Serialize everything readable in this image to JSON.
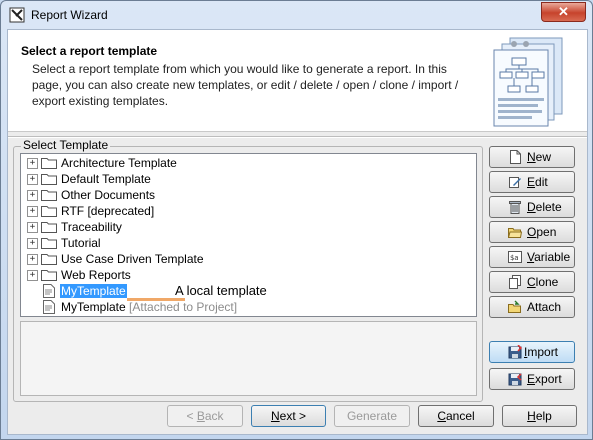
{
  "window": {
    "title": "Report Wizard",
    "close_symbol": "✕"
  },
  "header": {
    "title": "Select a report template",
    "description": "Select a report template from which you would like to generate a report. In this page, you can also create new templates, or edit / delete / open / clone / import / export existing templates."
  },
  "group": {
    "label": "Select Template"
  },
  "tree": {
    "folders": [
      {
        "label": "Architecture Template"
      },
      {
        "label": "Default Template"
      },
      {
        "label": "Other Documents"
      },
      {
        "label": "RTF [deprecated]"
      },
      {
        "label": "Traceability"
      },
      {
        "label": "Tutorial"
      },
      {
        "label": "Use Case Driven Template"
      },
      {
        "label": "Web Reports"
      }
    ],
    "templates": [
      {
        "label": "MyTemplate",
        "selected": true
      },
      {
        "label": "MyTemplate",
        "suffix": "[Attached to Project]"
      }
    ],
    "expander_symbol": "+",
    "annotation": "A local template"
  },
  "side_buttons": [
    {
      "key": "N",
      "rest": "ew",
      "icon": "new-document-icon"
    },
    {
      "key": "E",
      "rest": "dit",
      "icon": "edit-pencil-icon"
    },
    {
      "key": "D",
      "rest": "elete",
      "icon": "trash-icon"
    },
    {
      "key": "O",
      "rest": "pen",
      "icon": "open-folder-icon"
    },
    {
      "key": "V",
      "rest": "ariable",
      "icon": "variable-icon"
    },
    {
      "key": "C",
      "rest": "lone",
      "icon": "clone-icon"
    },
    {
      "key": "",
      "rest": "Attach",
      "icon": "attach-icon"
    },
    {
      "key": "I",
      "rest": "mport",
      "icon": "import-icon"
    },
    {
      "key": "E",
      "rest": "xport",
      "icon": "export-icon"
    }
  ],
  "bottom_buttons": {
    "back": {
      "prefix": "< ",
      "key": "B",
      "rest": "ack"
    },
    "next": {
      "key": "N",
      "rest": "ext >"
    },
    "generate": {
      "label": "Generate"
    },
    "cancel": {
      "key": "C",
      "rest": "ancel"
    },
    "help": {
      "key": "H",
      "rest": "elp"
    }
  },
  "colors": {
    "selection": "#3399ff",
    "annotation_line": "#f0a868",
    "close_button": "#c7432c"
  }
}
